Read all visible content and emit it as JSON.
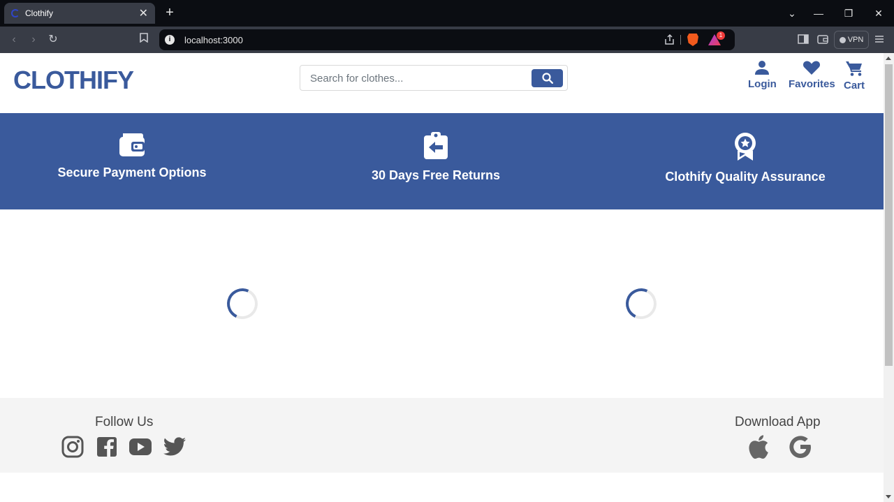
{
  "browser": {
    "tab_title": "Clothify",
    "tab_close": "✕",
    "new_tab": "+",
    "url": "localhost:3000",
    "vpn_label": "VPN",
    "rewards_badge": "1"
  },
  "header": {
    "logo": "CLOTHIFY",
    "search_placeholder": "Search for clothes...",
    "nav": [
      {
        "label": "Login",
        "icon": "user-icon"
      },
      {
        "label": "Favorites",
        "icon": "heart-icon"
      },
      {
        "label": "Cart",
        "icon": "cart-icon"
      }
    ]
  },
  "features": [
    {
      "label": "Secure Payment Options",
      "icon": "wallet-icon"
    },
    {
      "label": "30 Days Free Returns",
      "icon": "return-clipboard-icon"
    },
    {
      "label": "Clothify Quality Assurance",
      "icon": "award-ribbon-icon"
    }
  ],
  "footer": {
    "follow_heading": "Follow Us",
    "social": [
      "instagram-icon",
      "facebook-icon",
      "youtube-icon",
      "twitter-icon"
    ],
    "download_heading": "Download App",
    "apps": [
      "apple-icon",
      "google-icon"
    ]
  },
  "colors": {
    "brand": "#3a5a9c",
    "footer_bg": "#f4f4f4",
    "chrome_dark": "#0b0d12",
    "chrome_toolbar": "#383c46"
  }
}
